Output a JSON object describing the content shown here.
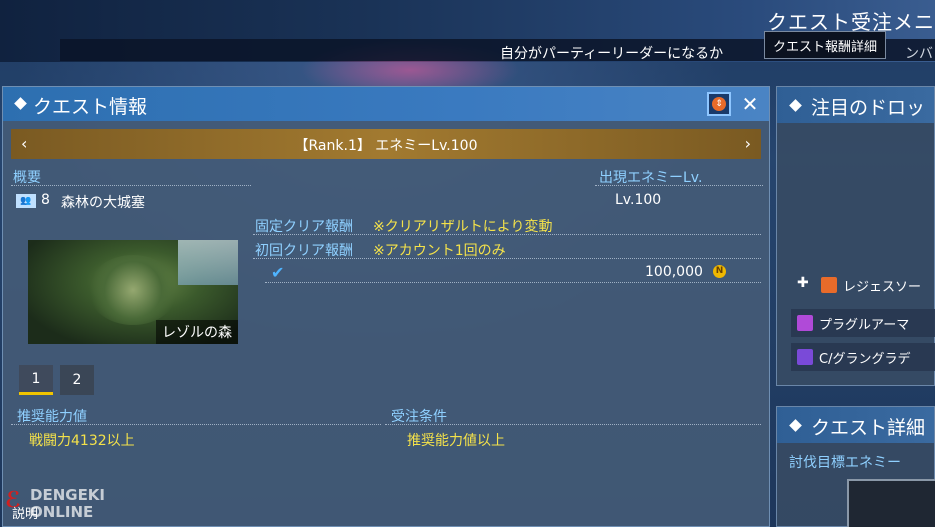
{
  "top": {
    "title": "クエスト受注メニ",
    "subtitle": "自分がパーティーリーダーになるか",
    "subtitle_right": "ンバ",
    "tooltip": "クエスト報酬詳細"
  },
  "quest_info": {
    "title": "クエスト情報",
    "rank_label": "【Rank.1】 エネミーLv.100",
    "overview_label": "概要",
    "party_count": "8",
    "area_name": "森林の大城塞",
    "enemy_lv_label": "出現エネミーLv.",
    "enemy_lv_value": "Lv.100",
    "fixed_reward_label": "固定クリア報酬",
    "fixed_reward_note": "※クリアリザルトにより変動",
    "first_reward_label": "初回クリア報酬",
    "first_reward_note": "※アカウント1回のみ",
    "first_reward_amount": "100,000",
    "map_label": "レゾルの森",
    "tabs": [
      "1",
      "2"
    ],
    "recommended_power_label": "推奨能力値",
    "recommended_power_value": "戦闘力4132以上",
    "order_condition_label": "受注条件",
    "order_condition_value": "推奨能力値以上"
  },
  "drops_panel": {
    "title": "注目のドロッ",
    "items": [
      {
        "label": "レジェスソー",
        "icon": "sword-icon",
        "color": "#e86b2a"
      },
      {
        "label": "プラグルアーマ",
        "icon": "armor-icon",
        "color": "#b04ad8"
      },
      {
        "label": "C/グラングラデ",
        "icon": "augment-icon",
        "color": "#7a4ad8"
      }
    ]
  },
  "quest_detail_panel": {
    "title": "クエスト詳細",
    "target_label": "討伐目標エネミー"
  },
  "watermark": {
    "line1": "DENGEKI",
    "line2": "ONLINE",
    "bottom_label": "説明"
  }
}
